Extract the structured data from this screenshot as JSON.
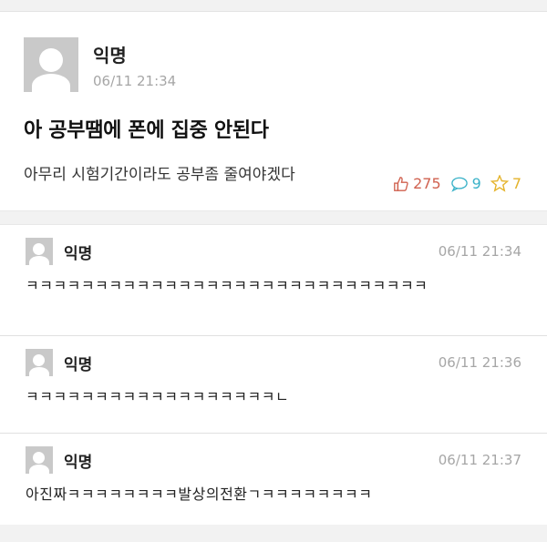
{
  "post": {
    "author": "익명",
    "time": "06/11 21:34",
    "title": "아 공부땜에 폰에 집중 안된다",
    "body": "아무리 시험기간이라도 공부좀 줄여야겠다",
    "likes": "275",
    "comments": "9",
    "scraps": "7"
  },
  "comments": [
    {
      "author": "익명",
      "time": "06/11 21:34",
      "text": "ㅋㅋㅋㅋㅋㅋㅋㅋㅋㅋㅋㅋㅋㅋㅋㅋㅋㅋㅋㅋㅋㅋㅋㅋㅋㅋㅋㅋㅋ"
    },
    {
      "author": "익명",
      "time": "06/11 21:36",
      "text": "ㅋㅋㅋㅋㅋㅋㅋㅋㅋㅋㅋㅋㅋㅋㅋㅋㅋㅋㄴ"
    },
    {
      "author": "익명",
      "time": "06/11 21:37",
      "text": "아진짜ㅋㅋㅋㅋㅋㅋㅋㅋ발상의전환ㄱㅋㅋㅋㅋㅋㅋㅋㅋ"
    }
  ],
  "icons": {
    "like": "thumbs-up-icon",
    "comment": "speech-bubble-icon",
    "scrap": "star-icon"
  },
  "colors": {
    "like": "#d0614f",
    "comment": "#3ab2c8",
    "scrap": "#e4b32b"
  }
}
